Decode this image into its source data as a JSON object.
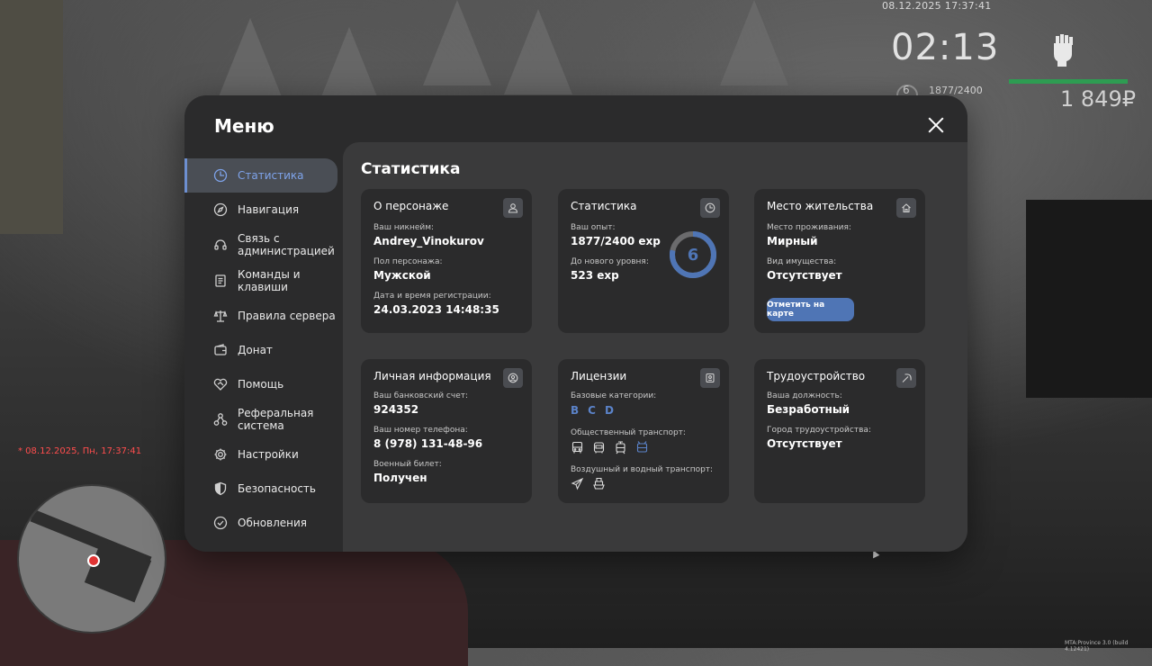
{
  "hud": {
    "datetime_top": "08.12.2025 17:37:41",
    "clock": "02:13",
    "level": "6",
    "exp": "1877/2400",
    "money": "1 849₽",
    "datetime_red": "* 08.12.2025, Пн, 17:37:41",
    "version": "MTA:Province 3.0 (build 4.12421)"
  },
  "menu": {
    "title": "Меню",
    "sidebar": [
      {
        "label": "Статистика",
        "icon": "clock-icon",
        "active": true
      },
      {
        "label": "Навигация",
        "icon": "compass-icon"
      },
      {
        "label": "Связь с администрацией",
        "icon": "headset-icon"
      },
      {
        "label": "Команды и клавиши",
        "icon": "document-icon"
      },
      {
        "label": "Правила сервера",
        "icon": "scales-icon"
      },
      {
        "label": "Донат",
        "icon": "wallet-icon"
      },
      {
        "label": "Помощь",
        "icon": "handshake-icon"
      },
      {
        "label": "Реферальная система",
        "icon": "network-icon"
      },
      {
        "label": "Настройки",
        "icon": "gear-icon"
      },
      {
        "label": "Безопасность",
        "icon": "shield-icon"
      },
      {
        "label": "Обновления",
        "icon": "check-circle-icon"
      }
    ],
    "content_title": "Статистика",
    "cards": {
      "character": {
        "title": "О персонаже",
        "nickname_label": "Ваш никнейм:",
        "nickname": "Andrey_Vinokurov",
        "gender_label": "Пол персонажа:",
        "gender": "Мужской",
        "reg_label": "Дата и время регистрации:",
        "reg": "24.03.2023 14:48:35"
      },
      "stats": {
        "title": "Статистика",
        "exp_label": "Ваш опыт:",
        "exp": "1877/2400 exp",
        "next_label": "До нового уровня:",
        "next": "523 exp",
        "level": "6",
        "progress": 0.782
      },
      "residence": {
        "title": "Место жительства",
        "place_label": "Место проживания:",
        "place": "Мирный",
        "property_label": "Вид имущества:",
        "property": "Отсутствует",
        "button": "Отметить на карте"
      },
      "personal": {
        "title": "Личная информация",
        "bank_label": "Ваш банковский счет:",
        "bank": "924352",
        "phone_label": "Ваш номер телефона:",
        "phone": "8 (978) 131-48-96",
        "military_label": "Военный билет:",
        "military": "Получен"
      },
      "licenses": {
        "title": "Лицензии",
        "base_label": "Базовые категории:",
        "base": [
          "B",
          "C",
          "D"
        ],
        "public_label": "Общественный транспорт:",
        "air_label": "Воздушный и водный транспорт:"
      },
      "employment": {
        "title": "Трудоустройство",
        "position_label": "Ваша должность:",
        "position": "Безработный",
        "city_label": "Город трудоустройства:",
        "city": "Отсутствует"
      }
    }
  },
  "colors": {
    "accent": "#4f75b5",
    "active_text": "#7ea3ea",
    "hud_bar": "#2e9c52"
  }
}
